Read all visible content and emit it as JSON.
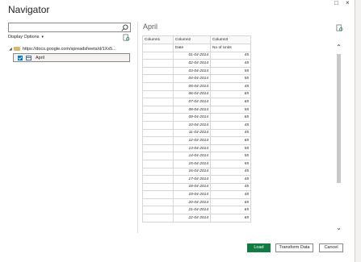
{
  "dialog": {
    "title": "Navigator",
    "window_controls": [
      "□",
      "×"
    ]
  },
  "left_pane": {
    "search": {
      "placeholder": "",
      "value": ""
    },
    "display_options_label": "Display Options",
    "tree": {
      "root_label": "https://docs.google.com/spreadsheets/d/1Xx5...",
      "items": [
        {
          "label": "April",
          "checked": true
        }
      ]
    }
  },
  "preview": {
    "title": "April",
    "columns": [
      "Column1",
      "Column2",
      "Column3"
    ],
    "header_row": [
      "",
      "Date",
      "No of Units"
    ],
    "rows": [
      [
        "",
        "01-04-2014",
        "45"
      ],
      [
        "",
        "02-04-2014",
        "45"
      ],
      [
        "",
        "03-04-2014",
        "55"
      ],
      [
        "",
        "04-04-2014",
        "55"
      ],
      [
        "",
        "05-04-2014",
        "45"
      ],
      [
        "",
        "06-04-2014",
        "65"
      ],
      [
        "",
        "07-04-2014",
        "65"
      ],
      [
        "",
        "08-04-2014",
        "55"
      ],
      [
        "",
        "09-04-2014",
        "65"
      ],
      [
        "",
        "10-04-2014",
        "45"
      ],
      [
        "",
        "11-04-2014",
        "45"
      ],
      [
        "",
        "12-04-2014",
        "65"
      ],
      [
        "",
        "13-04-2014",
        "55"
      ],
      [
        "",
        "14-04-2014",
        "55"
      ],
      [
        "",
        "15-04-2014",
        "55"
      ],
      [
        "",
        "16-04-2014",
        "45"
      ],
      [
        "",
        "17-04-2014",
        "45"
      ],
      [
        "",
        "18-04-2014",
        "45"
      ],
      [
        "",
        "19-04-2014",
        "45"
      ],
      [
        "",
        "20-04-2014",
        "65"
      ],
      [
        "",
        "21-04-2014",
        "65"
      ],
      [
        "",
        "22-04-2014",
        "65"
      ]
    ]
  },
  "buttons": {
    "load": "Load",
    "transform": "Transform Data",
    "cancel": "Cancel"
  },
  "colors": {
    "load_button": "#107c41",
    "checkbox": "#0078d4"
  }
}
